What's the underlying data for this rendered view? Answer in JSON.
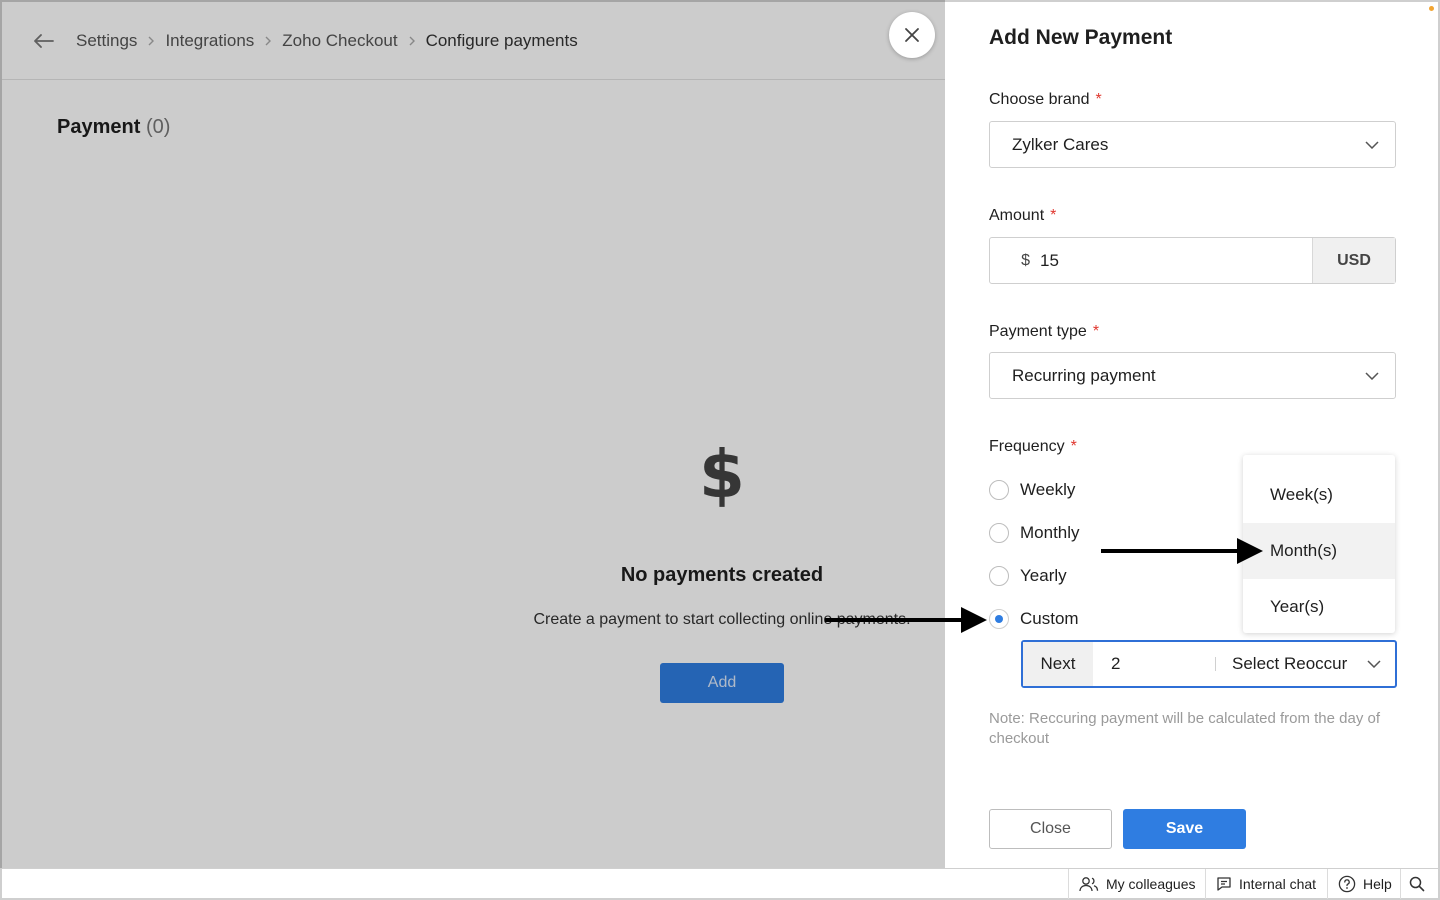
{
  "breadcrumb": {
    "items": [
      "Settings",
      "Integrations",
      "Zoho Checkout"
    ],
    "current": "Configure payments"
  },
  "page": {
    "title": "Payment",
    "count": "(0)"
  },
  "empty_state": {
    "icon": "dollar-icon",
    "title": "No payments created",
    "description": "Create a payment to start collecting online payments.",
    "add_label": "Add"
  },
  "drawer": {
    "title": "Add New Payment",
    "brand": {
      "label": "Choose brand",
      "value": "Zylker Cares"
    },
    "amount": {
      "label": "Amount",
      "currency_symbol": "$",
      "value": "15",
      "unit": "USD"
    },
    "payment_type": {
      "label": "Payment type",
      "value": "Recurring payment"
    },
    "frequency": {
      "label": "Frequency",
      "options": [
        "Weekly",
        "Monthly",
        "Yearly",
        "Custom"
      ],
      "selected": "Custom"
    },
    "custom": {
      "prefix": "Next",
      "value": "2",
      "select_placeholder": "Select Reoccur"
    },
    "reoccur_options": [
      "Week(s)",
      "Month(s)",
      "Year(s)"
    ],
    "reoccur_hovered": "Month(s)",
    "note": "Note: Reccuring payment will be calculated from the day of checkout",
    "close_label": "Close",
    "save_label": "Save",
    "required_mark": "*"
  },
  "bottombar": {
    "colleagues": "My colleagues",
    "chat": "Internal chat",
    "help": "Help"
  },
  "colors": {
    "primary": "#2f7de1",
    "required": "#e0362e",
    "focus_border": "#2f6fd6"
  }
}
